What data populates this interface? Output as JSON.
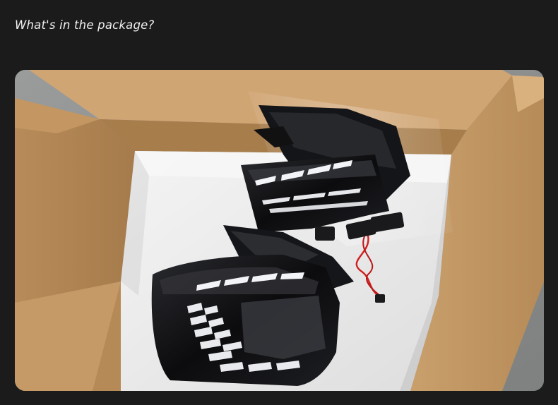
{
  "page": {
    "heading": "What's in the package?"
  },
  "photo": {
    "icon": "product-photo",
    "subject": "open cardboard box with a pair of LED tail lights",
    "colors": {
      "floor": "#8d8f8f",
      "cardboard": "#c49a67",
      "cardboard_dark": "#9f7748",
      "foam": "#ebebeb",
      "lamp_body": "#111214",
      "led": "#f3f4f7",
      "wire": "#d01f1f"
    }
  }
}
